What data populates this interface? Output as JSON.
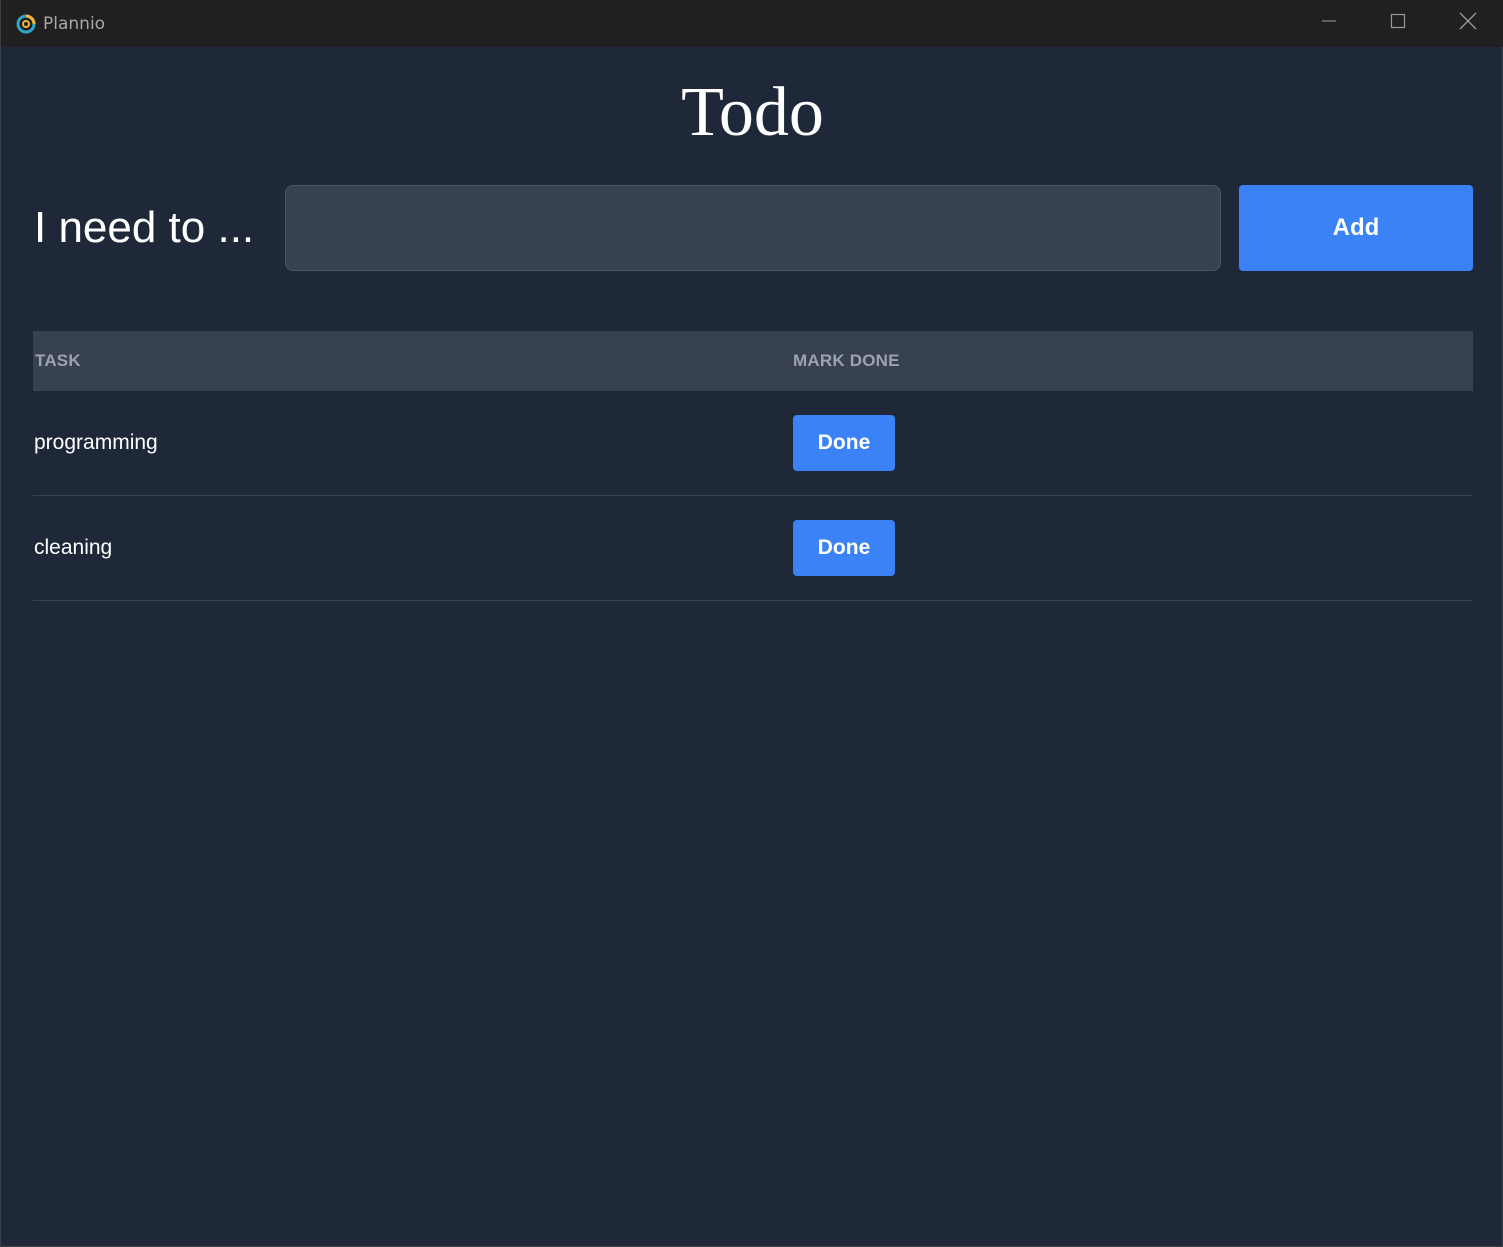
{
  "window": {
    "title": "Plannio",
    "controls": {
      "minimize_icon": "minimize-icon",
      "maximize_icon": "maximize-icon",
      "close_icon": "close-icon"
    }
  },
  "page": {
    "title": "Todo"
  },
  "form": {
    "label": "I need to ...",
    "input_value": "",
    "input_placeholder": "",
    "add_label": "Add"
  },
  "table": {
    "headers": [
      "TASK",
      "MARK DONE"
    ],
    "rows": [
      {
        "task": "programming",
        "action": "Done"
      },
      {
        "task": "cleaning",
        "action": "Done"
      }
    ]
  },
  "colors": {
    "background": "#1f2838",
    "titlebar": "#202020",
    "accent": "#3b82f6",
    "input_bg": "#374151",
    "header_bg": "#374151"
  }
}
